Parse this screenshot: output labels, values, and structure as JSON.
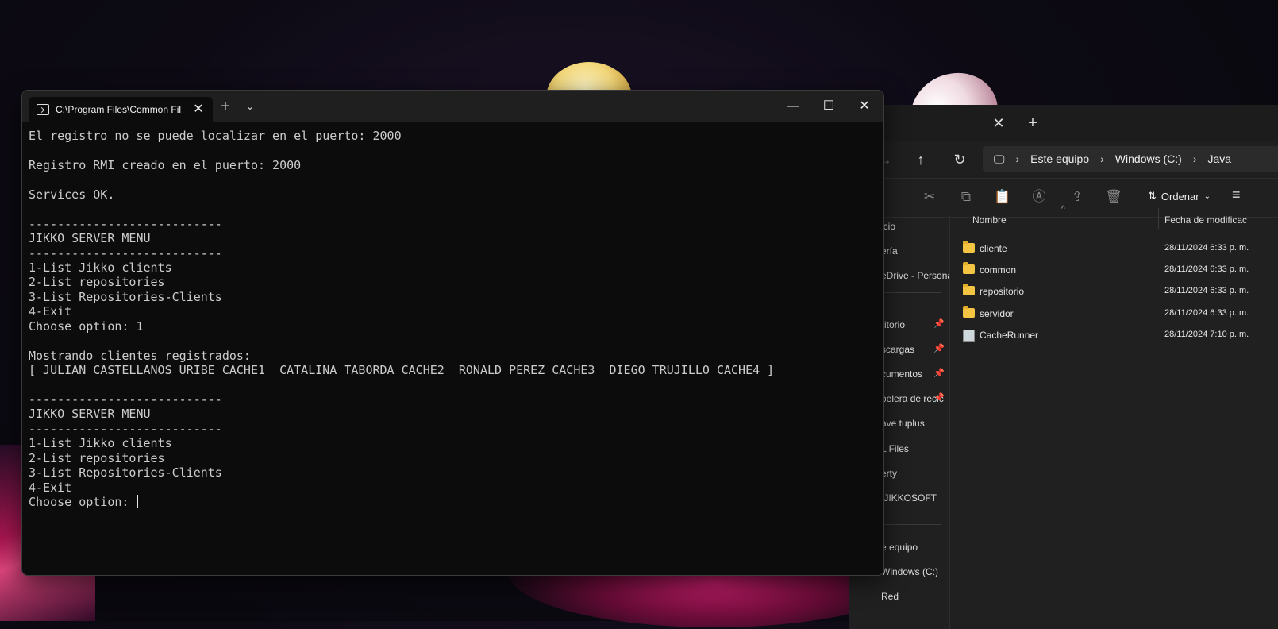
{
  "explorer": {
    "breadcrumbs": [
      "Este equipo",
      "Windows (C:)",
      "Java"
    ],
    "order_label": "Ordenar",
    "columns": {
      "name": "Nombre",
      "date": "Fecha de modificac"
    },
    "files": [
      {
        "name": "cliente",
        "date": "28/11/2024 6:33 p. m.",
        "type": "folder"
      },
      {
        "name": "common",
        "date": "28/11/2024 6:33 p. m.",
        "type": "folder"
      },
      {
        "name": "repositorio",
        "date": "28/11/2024 6:33 p. m.",
        "type": "folder"
      },
      {
        "name": "servidor",
        "date": "28/11/2024 6:33 p. m.",
        "type": "folder"
      },
      {
        "name": "CacheRunner",
        "date": "28/11/2024 7:10 p. m.",
        "type": "jar"
      }
    ],
    "sidebar": [
      {
        "label": "icio",
        "pinned": false
      },
      {
        "label": "ería",
        "pinned": false
      },
      {
        "label": "eDrive - Persona",
        "pinned": false
      },
      {
        "label": "ritorio",
        "pinned": true
      },
      {
        "label": "scargas",
        "pinned": true
      },
      {
        "label": "cumentos",
        "pinned": true
      },
      {
        "label": "pelera de recic",
        "pinned": true
      },
      {
        "label": "ave tuplus",
        "pinned": false
      },
      {
        "label": "L Files",
        "pinned": false
      },
      {
        "label": "erty",
        "pinned": false
      },
      {
        "label": "tJIKKOSOFT",
        "pinned": false
      },
      {
        "label": "e equipo",
        "pinned": false
      },
      {
        "label": "Windows (C:)",
        "pinned": false
      },
      {
        "label": "Red",
        "pinned": false
      }
    ]
  },
  "terminal": {
    "tab_title": "C:\\Program Files\\Common Fil",
    "lines": [
      "El registro no se puede localizar en el puerto: 2000",
      "",
      "Registro RMI creado en el puerto: 2000",
      "",
      "Services OK.",
      "",
      "---------------------------",
      "JIKKO SERVER MENU",
      "---------------------------",
      "1-List Jikko clients",
      "2-List repositories",
      "3-List Repositories-Clients",
      "4-Exit",
      "Choose option: 1",
      "",
      "Mostrando clientes registrados:",
      "[ JULIAN CASTELLANOS URIBE CACHE1  CATALINA TABORDA CACHE2  RONALD PEREZ CACHE3  DIEGO TRUJILLO CACHE4 ]",
      "",
      "---------------------------",
      "JIKKO SERVER MENU",
      "---------------------------",
      "1-List Jikko clients",
      "2-List repositories",
      "3-List Repositories-Clients",
      "4-Exit"
    ],
    "prompt": "Choose option: "
  }
}
